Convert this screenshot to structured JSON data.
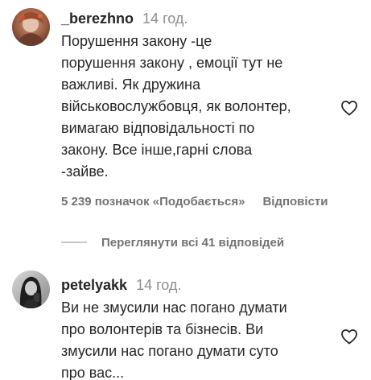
{
  "comments": [
    {
      "username": "_berezhno",
      "time": "14 год.",
      "avatar_icon": "avatar-photo-redhead",
      "text": "Порушення закону -це\nпорушення закону , емоції тут не\nважливі. Як дружина\nвійськовослужбовця, як волонтер,\nвимагаю відповідальності по\nзакону. Все інше,гарні слова\n-зайве.",
      "likes": "5 239 позначок «Подобається»",
      "reply_label": "Відповісти"
    },
    {
      "username": "petelyakk",
      "time": "14 год.",
      "avatar_icon": "avatar-photo-bw-selfie",
      "text": "Ви не змусили нас погано думати\nпро волонтерів та бізнесів. Ви\nзмусили нас погано думати суто\nпро вас..."
    }
  ],
  "view_replies": {
    "label": "Переглянути всі 41 відповідей"
  },
  "icons": {
    "like": "heart-outline-icon"
  },
  "colors": {
    "text": "#262626",
    "secondary": "#737373",
    "muted": "#8e8e8e"
  }
}
